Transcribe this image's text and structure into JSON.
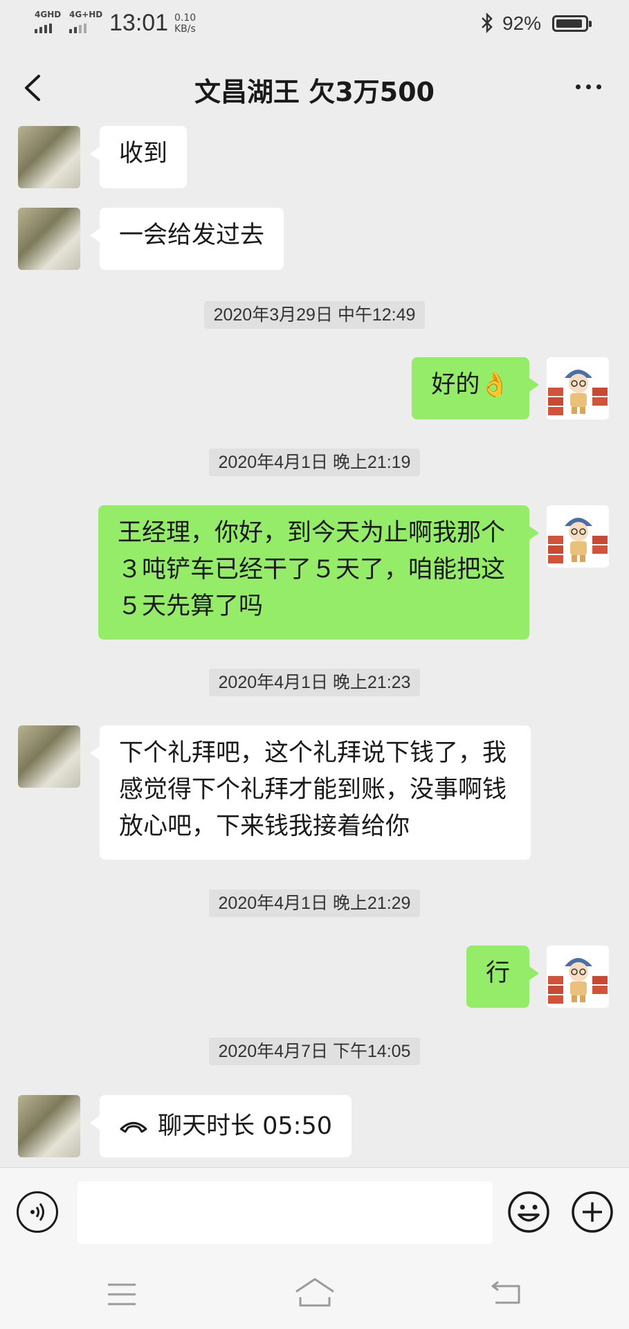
{
  "status_bar": {
    "signal1": "4GHD",
    "signal2": "4G+HD",
    "time": "13:01",
    "net_speed_value": "0.10",
    "net_speed_unit": "KB/s",
    "bluetooth_icon": "bluetooth-icon",
    "battery_percent": "92%",
    "battery_level": 0.92
  },
  "header": {
    "back_icon": "chevron-left-icon",
    "title": "文昌湖王        欠3万500",
    "more_icon": "more-dots-icon"
  },
  "messages": [
    {
      "type": "text",
      "side": "in",
      "text": "收到"
    },
    {
      "type": "text",
      "side": "in",
      "text": "一会给发过去"
    },
    {
      "type": "time",
      "text": "2020年3月29日 中午12:49"
    },
    {
      "type": "text",
      "side": "out",
      "text": "好的",
      "emoji": "👌"
    },
    {
      "type": "time",
      "text": "2020年4月1日 晚上21:19"
    },
    {
      "type": "text",
      "side": "out",
      "text": "王经理，你好，到今天为止啊我那个３吨铲车已经干了５天了，咱能把这５天先算了吗"
    },
    {
      "type": "time",
      "text": "2020年4月1日 晚上21:23"
    },
    {
      "type": "text",
      "side": "in",
      "text": "下个礼拜吧，这个礼拜说下钱了，我感觉得下个礼拜才能到账，没事啊钱放心吧，下来钱我接着给你"
    },
    {
      "type": "time",
      "text": "2020年4月1日 晚上21:29"
    },
    {
      "type": "text",
      "side": "out",
      "text": "行"
    },
    {
      "type": "time",
      "text": "2020年4月7日 下午14:05"
    },
    {
      "type": "call",
      "side": "in",
      "text": "聊天时长 05:50",
      "icon": "phone-handset-icon"
    }
  ],
  "input_bar": {
    "voice_icon": "voice-icon",
    "input_value": "",
    "emoji_icon": "emoji-icon",
    "plus_icon": "plus-circle-icon"
  },
  "system_nav": {
    "menu_icon": "menu-icon",
    "home_icon": "home-icon",
    "back_icon": "back-arrow-icon"
  },
  "colors": {
    "background": "#ededed",
    "outgoing_bubble": "#95ec69",
    "incoming_bubble": "#ffffff",
    "timestamp_bg": "#e0e0e0"
  }
}
